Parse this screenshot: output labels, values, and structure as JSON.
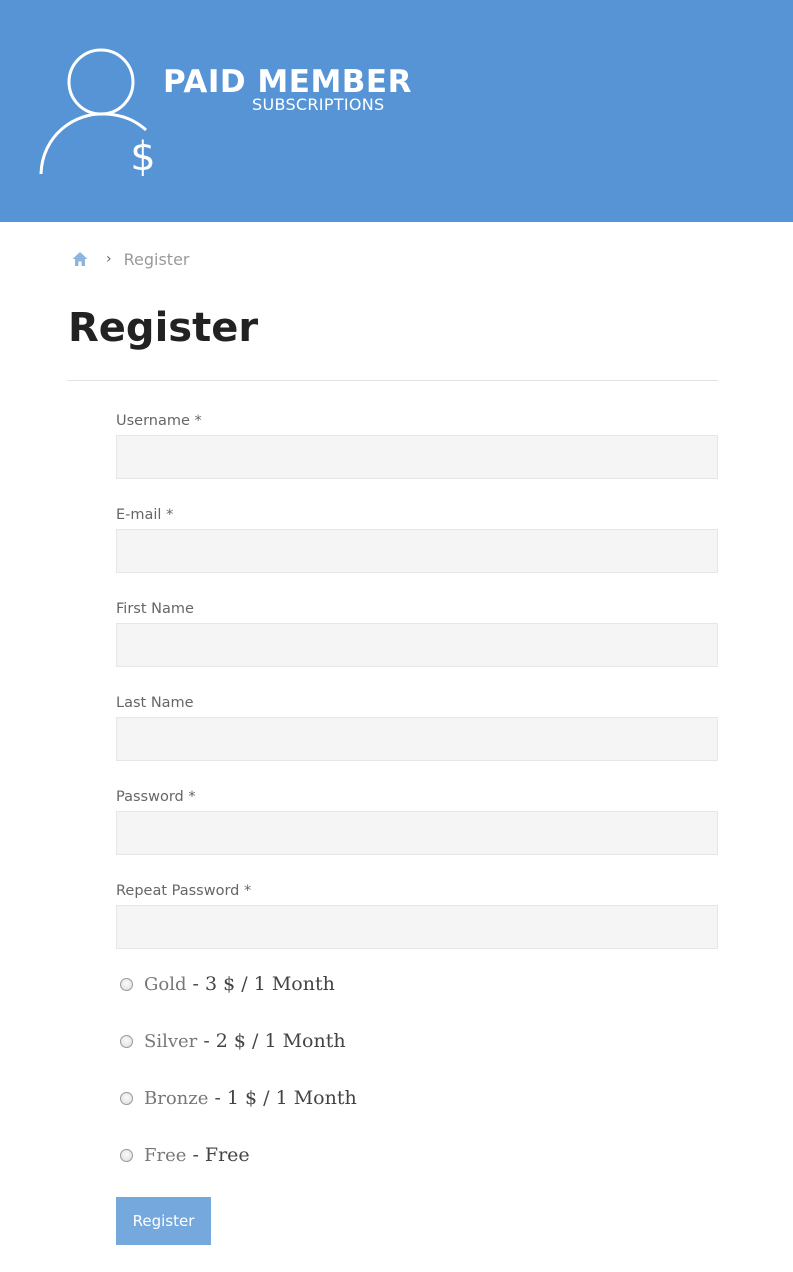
{
  "header": {
    "logo_title": "PAID MEMBER",
    "logo_subtitle": "SUBSCRIPTIONS",
    "background_color": "#5694d5",
    "logo_icon": "user-dollar-icon"
  },
  "breadcrumb": {
    "home_icon": "home-icon",
    "separator": "›",
    "current": "Register"
  },
  "page": {
    "title": "Register"
  },
  "form": {
    "fields": [
      {
        "label": "Username *",
        "value": "",
        "type": "text"
      },
      {
        "label": "E-mail *",
        "value": "",
        "type": "email"
      },
      {
        "label": "First Name",
        "value": "",
        "type": "text"
      },
      {
        "label": "Last Name",
        "value": "",
        "type": "text"
      },
      {
        "label": "Password *",
        "value": "",
        "type": "password"
      },
      {
        "label": "Repeat Password *",
        "value": "",
        "type": "password"
      }
    ],
    "plans": [
      {
        "name": "Gold",
        "price": " - 3 $ / 1 Month",
        "selected": false
      },
      {
        "name": "Silver",
        "price": " - 2 $ / 1 Month",
        "selected": false
      },
      {
        "name": "Bronze",
        "price": " - 1 $ / 1 Month",
        "selected": false
      },
      {
        "name": "Free",
        "price": " - Free",
        "selected": false
      }
    ],
    "submit_label": "Register",
    "submit_color": "#75a9dd"
  }
}
